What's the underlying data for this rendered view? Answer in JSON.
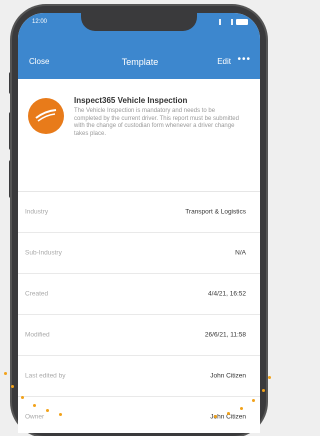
{
  "status_bar": {
    "time": "12:00"
  },
  "nav": {
    "close_label": "Close",
    "title": "Template",
    "edit_label": "Edit",
    "more_label": "•••"
  },
  "template": {
    "title": "Inspect365 Vehicle Inspection",
    "description": "The Vehicle Inspection is mandatory and needs to be completed by the current driver. This report must be submitted with the change of custodian form whenever a driver change takes place.",
    "logo_icon": "inspect365-logo-icon"
  },
  "details": [
    {
      "label": "Industry",
      "value": "Transport & Logistics"
    },
    {
      "label": "Sub-Industry",
      "value": "N/A"
    },
    {
      "label": "Created",
      "value": "4/4/21, 16:52"
    },
    {
      "label": "Modified",
      "value": "26/6/21, 11:58"
    },
    {
      "label": "Last edited by",
      "value": "John Citizen"
    },
    {
      "label": "Owner",
      "value": "John Citizen"
    }
  ],
  "colors": {
    "header": "#3d87ce",
    "logo": "#e87b1a",
    "accent_dots": "#f2a21a"
  }
}
